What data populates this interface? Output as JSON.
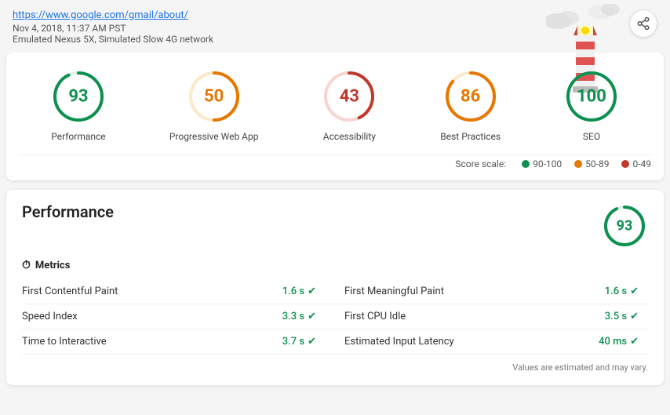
{
  "header": {
    "url": "https://www.google.com/gmail/about/",
    "timestamp": "Nov 4, 2018, 11:37 AM PST",
    "device": "Emulated Nexus 5X, Simulated Slow 4G network",
    "share_label": "share"
  },
  "scores": [
    {
      "id": "performance",
      "label": "Performance",
      "value": 93,
      "color": "#0d904f",
      "track_color": "#d9f4e8"
    },
    {
      "id": "pwa",
      "label": "Progressive Web App",
      "value": 50,
      "color": "#e67700",
      "track_color": "#fde8c8"
    },
    {
      "id": "accessibility",
      "label": "Accessibility",
      "value": 43,
      "color": "#c0392b",
      "track_color": "#f9d5d2"
    },
    {
      "id": "best_practices",
      "label": "Best Practices",
      "value": 86,
      "color": "#e67700",
      "track_color": "#fde8c8"
    },
    {
      "id": "seo",
      "label": "SEO",
      "value": 100,
      "color": "#0d904f",
      "track_color": "#d9f4e8"
    }
  ],
  "score_scale": {
    "label": "Score scale:",
    "ranges": [
      {
        "label": "90-100",
        "color": "#0d904f"
      },
      {
        "label": "50-89",
        "color": "#e67700"
      },
      {
        "label": "0-49",
        "color": "#c0392b"
      }
    ]
  },
  "performance_section": {
    "title": "Performance",
    "score": 93,
    "metrics_label": "Metrics",
    "metrics": [
      {
        "name": "First Contentful Paint",
        "value": "1.6 s",
        "side": "left"
      },
      {
        "name": "First Meaningful Paint",
        "value": "1.6 s",
        "side": "right"
      },
      {
        "name": "Speed Index",
        "value": "3.3 s",
        "side": "left"
      },
      {
        "name": "First CPU Idle",
        "value": "3.5 s",
        "side": "right"
      },
      {
        "name": "Time to Interactive",
        "value": "3.7 s",
        "side": "left"
      },
      {
        "name": "Estimated Input Latency",
        "value": "40 ms",
        "side": "right"
      }
    ],
    "footnote": "Values are estimated and may vary."
  }
}
